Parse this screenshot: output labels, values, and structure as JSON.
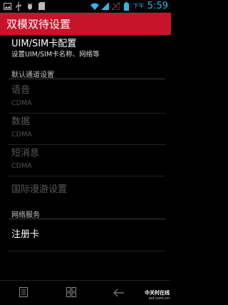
{
  "status_bar": {
    "left_icons": [
      "image-notification-icon",
      "usb-icon",
      "debug-icon",
      "sd-card-icon"
    ],
    "right_icons": [
      "wifi-icon",
      "signal-icon",
      "signal-off-icon",
      "battery-icon"
    ],
    "ampm": "下午",
    "time": "5:59",
    "time_color": "#33b5e5"
  },
  "title_bar": {
    "title": "双模双待设置",
    "color": "#c8142a"
  },
  "settings": {
    "uim_sim": {
      "title": "UIM/SIM卡配置",
      "summary": "设置UIM/SIM卡名称、网络等"
    },
    "default_channel_header": "默认通道设置",
    "voice": {
      "title": "语音",
      "summary": "CDMA"
    },
    "data": {
      "title": "数据",
      "summary": "CDMA"
    },
    "sms": {
      "title": "短消息",
      "summary": "CDMA"
    },
    "roaming": {
      "title": "国际漫游设置"
    },
    "network_services_header": "网络服务",
    "register_card": {
      "title": "注册卡"
    }
  },
  "nav_bar": {
    "icons": [
      "menu-icon",
      "recent-apps-icon",
      "back-icon"
    ]
  },
  "watermark": {
    "main": "中关村在线",
    "sub": "zol.com.cn"
  }
}
